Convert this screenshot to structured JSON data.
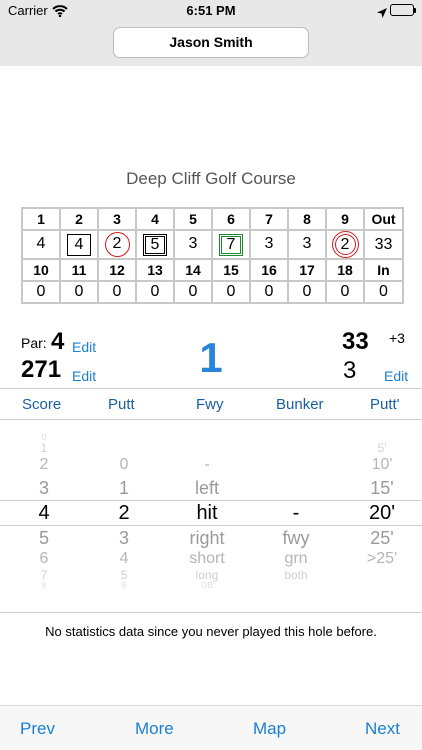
{
  "status_bar": {
    "carrier": "Carrier",
    "time": "6:51 PM"
  },
  "player_name": "Jason Smith",
  "course_name": "Deep Cliff Golf Course",
  "scorecard": {
    "front_holes": [
      "1",
      "2",
      "3",
      "4",
      "5",
      "6",
      "7",
      "8",
      "9",
      "Out"
    ],
    "front_scores": [
      "4",
      "4",
      "2",
      "5",
      "3",
      "7",
      "3",
      "3",
      "2",
      "33"
    ],
    "back_holes": [
      "10",
      "11",
      "12",
      "13",
      "14",
      "15",
      "16",
      "17",
      "18",
      "In"
    ],
    "back_scores": [
      "0",
      "0",
      "0",
      "0",
      "0",
      "0",
      "0",
      "0",
      "0",
      "0"
    ]
  },
  "hole_info": {
    "par_label": "Par:",
    "par": "4",
    "yards": "271",
    "edit_label": "Edit",
    "hole_number": "1",
    "total": "33",
    "to_par": "+3",
    "current_score": "3"
  },
  "picker": {
    "headers": [
      "Score",
      "Putt",
      "Fwy",
      "Bunker",
      "Putt'"
    ],
    "score_options": [
      "0",
      "1",
      "2",
      "3",
      "4",
      "5",
      "6",
      "7",
      "8"
    ],
    "putt_options": [
      "0",
      "1",
      "2",
      "3",
      "4",
      "5",
      "6"
    ],
    "fwy_options": [
      "-",
      "left",
      "hit",
      "right",
      "short",
      "long",
      "OB"
    ],
    "bunker_options": [
      "-",
      "fwy",
      "grn",
      "both"
    ],
    "puttdist_options": [
      "5'",
      "10'",
      "15'",
      "20'",
      "25'",
      ">25'"
    ]
  },
  "message": "No statistics data since you never played this hole before.",
  "bottom_nav": {
    "prev": "Prev",
    "more": "More",
    "map": "Map",
    "next": "Next"
  },
  "colors": {
    "accent": "#1a7fd4",
    "hole_number": "#2a84d9",
    "birdie": "#d51a1a",
    "highlight": "#1e8b2e",
    "picker_header": "#1a5fa0"
  }
}
